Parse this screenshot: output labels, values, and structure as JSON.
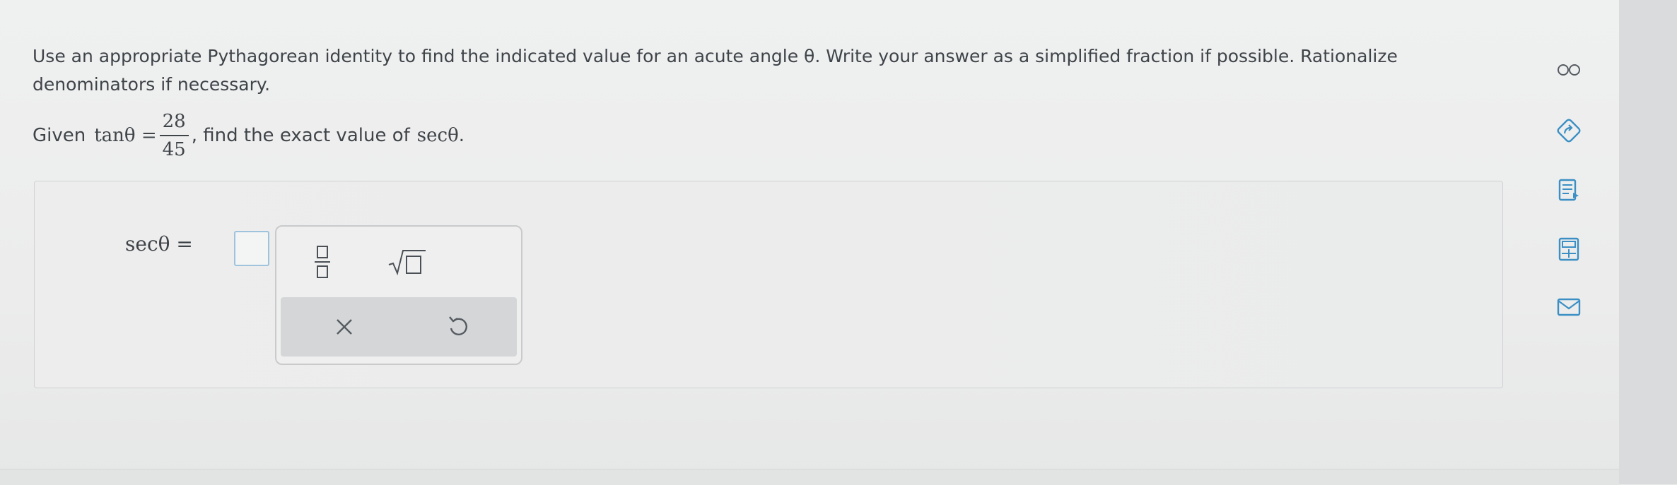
{
  "question": {
    "prompt": "Use an appropriate Pythagorean identity to find the indicated value for an acute angle θ. Write your answer as a simplified fraction if possible. Rationalize denominators if necessary.",
    "given_prefix": "Given",
    "given_lhs": "tanθ =",
    "fraction_numerator": "28",
    "fraction_denominator": "45",
    "given_suffix": ", find the exact value of",
    "target": "secθ",
    "period": "."
  },
  "answer": {
    "label": "secθ =",
    "value": ""
  },
  "keypad": {
    "keys": [
      "fraction-key",
      "square-root-key",
      "clear-key",
      "undo-key"
    ]
  },
  "sidebar_tools": [
    "infinity-icon",
    "guided-solution-icon",
    "read-aloud-icon",
    "calculator-icon",
    "email-icon"
  ],
  "colors": {
    "input_border": "#9ec3dc",
    "text": "#3f4449",
    "tool_icon": "#3b8fc4"
  }
}
